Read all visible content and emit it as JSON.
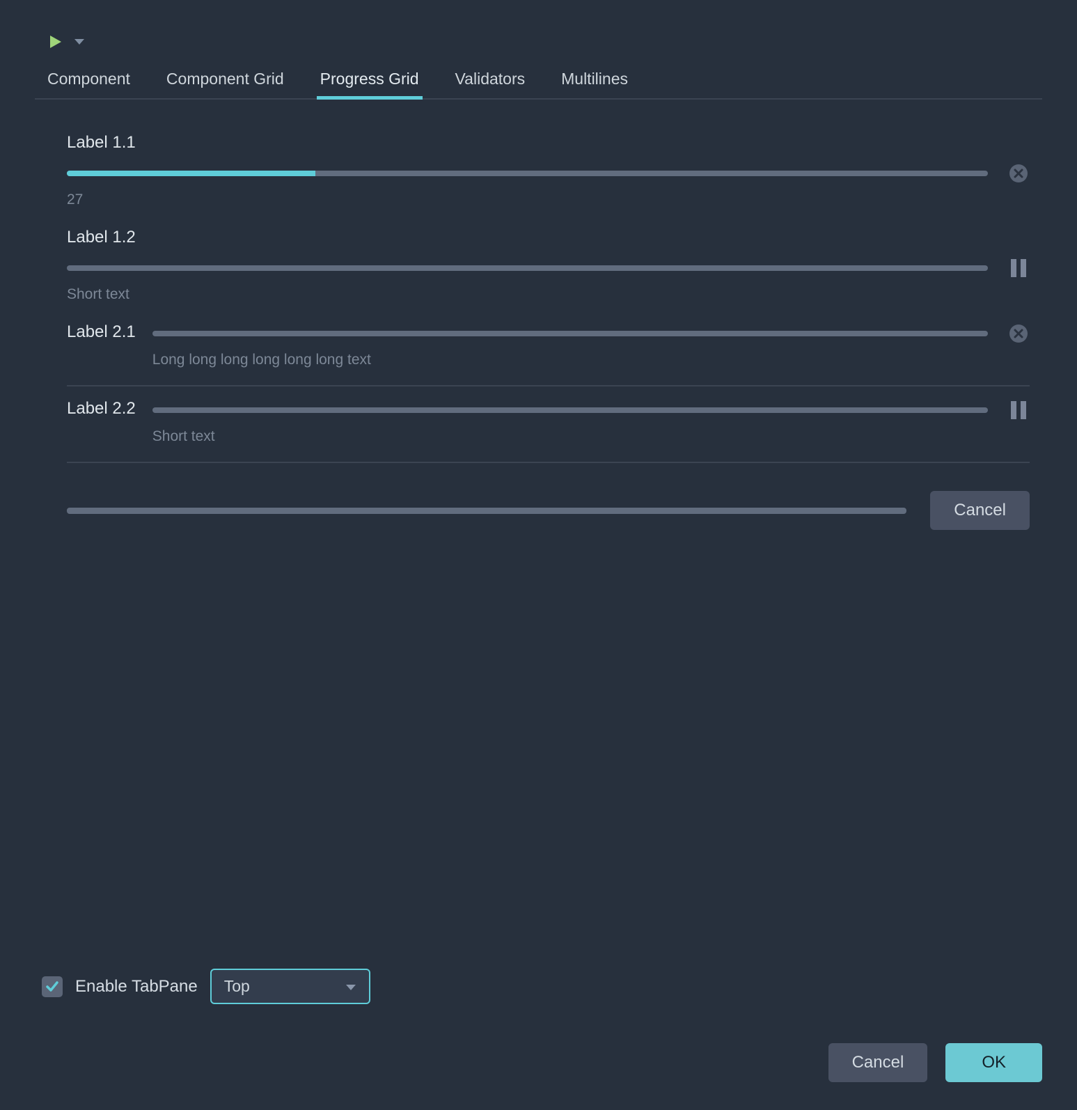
{
  "colors": {
    "accent": "#5fcdd9",
    "bg": "#27303d",
    "bar": "#616c7e"
  },
  "toolbar": {
    "play": "run",
    "dropdown": "options"
  },
  "tabs": [
    {
      "label": "Component",
      "active": false
    },
    {
      "label": "Component Grid",
      "active": false
    },
    {
      "label": "Progress Grid",
      "active": true
    },
    {
      "label": "Validators",
      "active": false
    },
    {
      "label": "Multilines",
      "active": false
    }
  ],
  "rows": [
    {
      "label": "Label 1.1",
      "progress": 27,
      "subtext": "27",
      "action": "close",
      "layout": "stacked"
    },
    {
      "label": "Label 1.2",
      "progress": 0,
      "subtext": "Short text",
      "action": "pause",
      "layout": "stacked"
    },
    {
      "label": "Label 2.1",
      "progress": 0,
      "subtext": "Long long long long long long text",
      "action": "close",
      "layout": "side"
    },
    {
      "label": "Label 2.2",
      "progress": 0,
      "subtext": "Short text",
      "action": "pause",
      "layout": "side"
    }
  ],
  "bottom": {
    "progress": 0,
    "cancel": "Cancel"
  },
  "enable": {
    "checked": true,
    "label": "Enable TabPane"
  },
  "select": {
    "value": "Top"
  },
  "buttons": {
    "cancel": "Cancel",
    "ok": "OK"
  }
}
